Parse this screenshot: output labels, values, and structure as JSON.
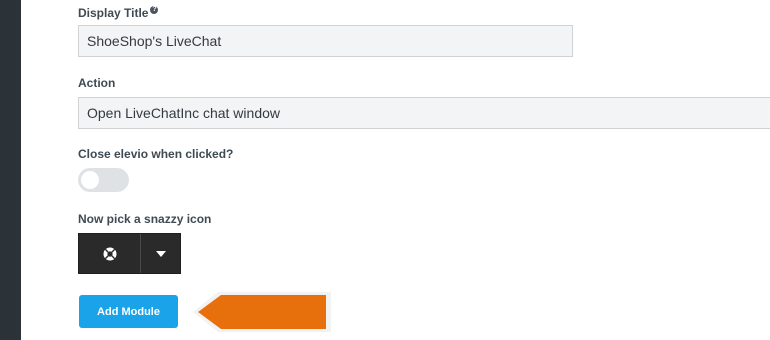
{
  "display_title": {
    "label": "Display Title",
    "help_icon": "question-circle-icon",
    "value": "ShoeShop's LiveChat"
  },
  "action": {
    "label": "Action",
    "value": "Open LiveChatInc chat window"
  },
  "close_when_clicked": {
    "label": "Close elevio when clicked?",
    "enabled": false
  },
  "icon_picker": {
    "label": "Now pick a snazzy icon",
    "selected_icon": "lifebuoy-icon",
    "caret_icon": "caret-down-icon"
  },
  "add_module_button": {
    "label": "Add Module",
    "color": "#1aa3e8"
  },
  "callout_arrow": {
    "color": "#e8700c"
  },
  "sidebar": {
    "color": "#2b3338"
  }
}
